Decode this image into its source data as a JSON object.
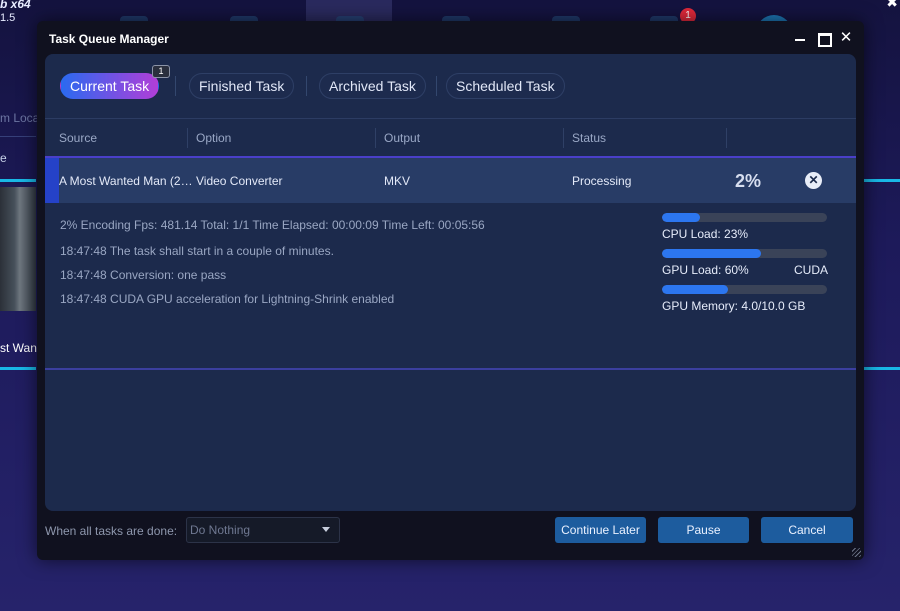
{
  "background": {
    "app_title": "b x64",
    "app_version": "1.5",
    "badge_count": "1",
    "location_text": "m Loca",
    "side_letter": "e",
    "thumb_name": "st Want"
  },
  "dialog": {
    "title": "Task Queue Manager",
    "tabs": [
      {
        "label": "Current Task",
        "badge": "1"
      },
      {
        "label": "Finished Task"
      },
      {
        "label": "Archived Task"
      },
      {
        "label": "Scheduled Task"
      }
    ],
    "columns": [
      "Source",
      "Option",
      "Output",
      "Status"
    ],
    "task": {
      "source": "A Most Wanted Man (2…",
      "option": "Video Converter",
      "output": "MKV",
      "status": "Processing",
      "percent": "2%"
    },
    "log": [
      "2%  Encoding Fps: 481.14  Total: 1/1  Time Elapsed: 00:00:09  Time Left: 00:05:56",
      "18:47:48  The task shall start in a couple of minutes.",
      "18:47:48  Conversion: one pass",
      "18:47:48  CUDA GPU acceleration for Lightning-Shrink enabled"
    ],
    "meters": [
      {
        "label": "CPU Load: 23%",
        "extra": "",
        "fill": 0.23
      },
      {
        "label": "GPU Load: 60%",
        "extra": "CUDA",
        "fill": 0.6
      },
      {
        "label": "GPU Memory: 4.0/10.0 GB",
        "extra": "",
        "fill": 0.4
      }
    ],
    "footer": {
      "when_done_label": "When all tasks are done:",
      "when_done_value": "Do Nothing",
      "continue_later": "Continue Later",
      "pause": "Pause",
      "cancel": "Cancel"
    }
  },
  "colors": {
    "accent": "#2c76ef",
    "tab_gradient_start": "#2a6af0",
    "tab_gradient_end": "#b13ed8",
    "button": "#1d5c9e"
  }
}
